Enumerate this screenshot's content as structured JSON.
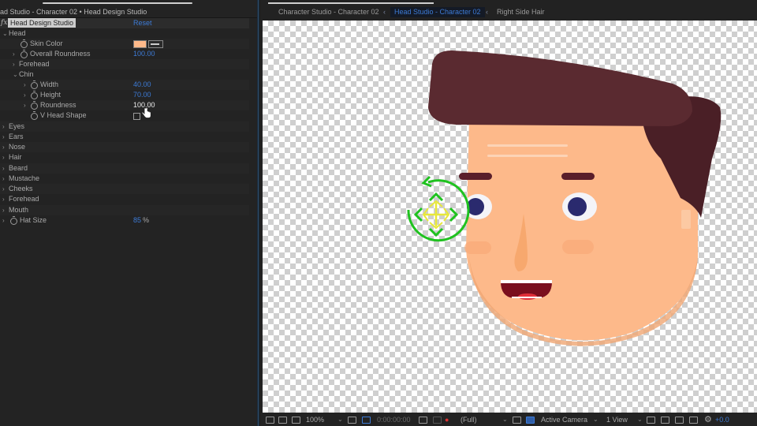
{
  "effect_controls": {
    "title": "ad Studio - Character 02 • Head Design Studio",
    "effect_name": "Head Design Studio",
    "fx_label": "fx",
    "reset_label": "Reset",
    "rows": [
      {
        "label": "Head",
        "expanded": true
      },
      {
        "label": "Skin Color",
        "swatch": "#fdb98a"
      },
      {
        "label": "Overall Roundness",
        "value": "100.00"
      },
      {
        "label": "Forehead",
        "expanded": false
      },
      {
        "label": "Chin",
        "expanded": true
      },
      {
        "label": "Width",
        "value": "40.00"
      },
      {
        "label": "Height",
        "value": "70.00"
      },
      {
        "label": "Roundness",
        "value": "100.00"
      },
      {
        "label": "V Head Shape",
        "checked": false
      },
      {
        "label": "Eyes"
      },
      {
        "label": "Ears"
      },
      {
        "label": "Nose"
      },
      {
        "label": "Hair"
      },
      {
        "label": "Beard"
      },
      {
        "label": "Mustache"
      },
      {
        "label": "Cheeks"
      },
      {
        "label": "Forehead"
      },
      {
        "label": "Mouth"
      },
      {
        "label": "Hat Size",
        "value": "85",
        "unit": "%"
      }
    ]
  },
  "viewer": {
    "breadcrumbs": [
      {
        "label": "Character Studio - Character 02",
        "active": false
      },
      {
        "label": "Head Studio - Character 02",
        "active": true
      },
      {
        "label": "Right Side Hair",
        "active": false
      }
    ],
    "toolbar": {
      "zoom": "100%",
      "timecode": "0:00:00:00",
      "resolution": "(Full)",
      "camera": "Active Camera",
      "views": "1 View",
      "exposure": "+0.0"
    },
    "colors": {
      "skin": "#fdb98a",
      "hair": "#5a2a30",
      "hair_dark": "#4a1f26",
      "eye_pupil": "#2a2a6e",
      "gizmo_green": "#1fc21f",
      "gizmo_yellow": "#e8e83a",
      "accent_blue": "#3d7bd6"
    }
  }
}
